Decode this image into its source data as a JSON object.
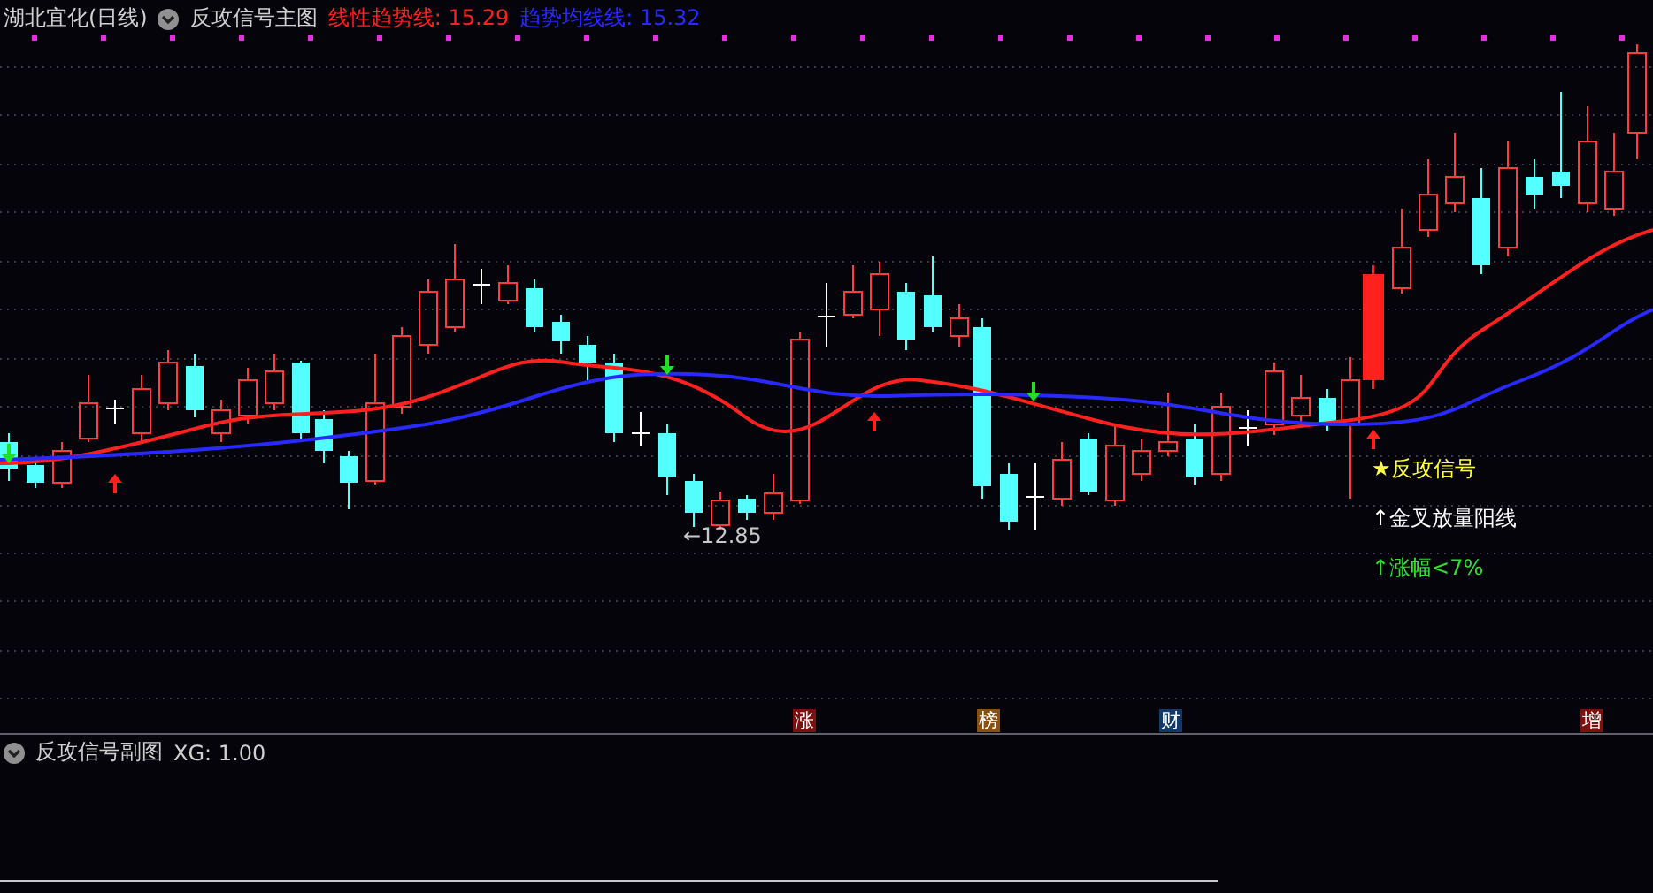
{
  "main_panel": {
    "stock_title": "湖北宜化(日线)",
    "indicator_name": "反攻信号主图",
    "lines": [
      {
        "label": "线性趋势线:",
        "value": "15.29",
        "color": "#ff2020"
      },
      {
        "label": "趋势均线线:",
        "value": "15.32",
        "color": "#2828ff"
      }
    ],
    "low_marker": "←12.85",
    "legend": [
      {
        "text": "★反攻信号",
        "color": "#ffff40"
      },
      {
        "text": "↑金叉放量阳线",
        "color": "#ffffff"
      },
      {
        "text": "↑涨幅<7%",
        "color": "#30e030"
      }
    ],
    "tags": [
      {
        "text": "涨",
        "color": "#7a1010"
      },
      {
        "text": "榜",
        "color": "#8a5010"
      },
      {
        "text": "财",
        "color": "#103a6a"
      },
      {
        "text": "增",
        "color": "#7a1010"
      }
    ]
  },
  "sub_panel": {
    "indicator_name": "反攻信号副图",
    "reading": "XG: 1.00"
  }
}
